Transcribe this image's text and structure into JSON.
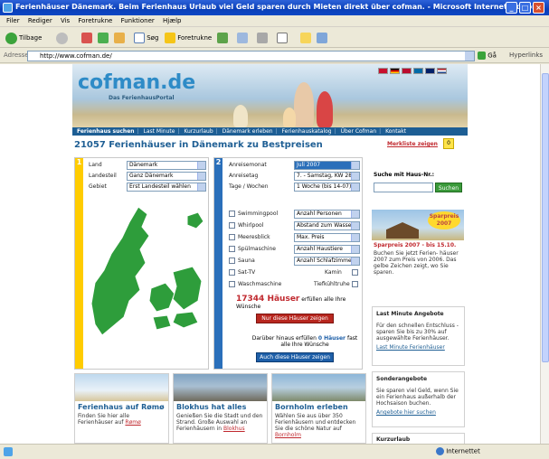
{
  "window": {
    "title": "Ferienhäuser Dänemark. Beim Ferienhaus Urlaub viel Geld sparen durch Mieten direkt über cofman. - Microsoft Internet Explorer"
  },
  "menu": [
    "Filer",
    "Rediger",
    "Vis",
    "Foretrukne",
    "Funktioner",
    "Hjælp"
  ],
  "toolbar": {
    "back": "Tilbage",
    "search": "Søg",
    "favorites": "Foretrukne"
  },
  "address": {
    "label": "Adresse",
    "url": "http://www.cofman.de/",
    "go": "Gå",
    "links": "Hyperlinks"
  },
  "status": {
    "zone": "Internettet"
  },
  "site": {
    "logo": "cofman.de",
    "logo_sub": "Das FerienhausPortal",
    "nav": [
      "Ferienhaus suchen",
      "Last Minute",
      "Kurzurlaub",
      "Dänemark erleben",
      "Ferienhauskatalog",
      "Über Cofman",
      "Kontakt"
    ],
    "headline": "21057 Ferienhäuser in Dänemark zu Bestpreisen",
    "merkliste": "Merkliste zeigen",
    "merkliste_count": "0"
  },
  "step1": {
    "number": "1",
    "fields": [
      {
        "label": "Land",
        "value": "Dänemark"
      },
      {
        "label": "Landesteil",
        "value": "Ganz Dänemark"
      },
      {
        "label": "Gebiet",
        "value": "Erst Landesteil wählen"
      }
    ]
  },
  "step2": {
    "number": "2",
    "fields": [
      {
        "label": "Anreisemonat",
        "value": "Juli 2007"
      },
      {
        "label": "Anreisetag",
        "value": "7. - Samstag, KW 28"
      },
      {
        "label": "Tage / Wochen",
        "value": "1 Woche  (bis 14-07)"
      }
    ],
    "options": [
      {
        "label": "Swimmingpool",
        "select": "Anzahl Personen"
      },
      {
        "label": "Whirlpool",
        "select": "Abstand zum Wasser"
      },
      {
        "label": "Meeresblick",
        "select": "Max. Preis"
      },
      {
        "label": "Spülmaschine",
        "select": "Anzahl Haustiere"
      },
      {
        "label": "Sauna",
        "select": "Anzahl Schlafzimmer"
      }
    ],
    "opt_satv": "Sat-TV",
    "opt_kamin": "Kamin",
    "opt_wasch": "Waschmaschine",
    "opt_tief": "Tiefkühltruhe",
    "count_value": "17344 Häuser",
    "count_suffix": "erfüllen alle Ihre Wünsche",
    "btn_only": "Nur diese Häuser zeigen",
    "extra_prefix": "Darüber hinaus erfüllen",
    "extra_value": "0 Häuser",
    "extra_suffix": "fast alle Ihre Wünsche",
    "btn_also": "Auch diese Häuser zeigen"
  },
  "side": {
    "search_label": "Suche mit Haus-Nr.:",
    "search_button": "Suchen",
    "sparpreis_badge": "Sparpreis 2007",
    "sparpreis_title": "Sparpreis 2007 - bis 15.10.",
    "sparpreis_text": "Buchen Sie jetzt Ferien- häuser 2007 zum Preis von 2006. Das gelbe Zeichen zeigt, wo Sie sparen.",
    "lastminute_title": "Last Minute Angebote",
    "lastminute_text": "Für den schnellen Entschluss - sparen Sie bis zu 30% auf ausgewählte Ferienhäuser.",
    "lastminute_link": "Last Minute Ferienhäuser",
    "sonder_title": "Sonderangebote",
    "sonder_text": "Sie sparen viel Geld, wenn Sie ein Ferienhaus außerhalb der Hochsaison buchen.",
    "sonder_link": "Angebote hier suchen",
    "kurz_title": "Kurzurlaub"
  },
  "teasers": [
    {
      "title": "Ferienhaus auf Rømø",
      "text": "Finden Sie hier alle Ferienhäuser auf ",
      "link": "Rømø"
    },
    {
      "title": "Blokhus hat alles",
      "text": "Genießen Sie die Stadt und den Strand. Große Auswahl an Ferienhäusern in ",
      "link": "Blokhus"
    },
    {
      "title": "Bornholm erleben",
      "text": "Wählen Sie aus über 350 Ferienhäusern und entdecken Sie die schöne Natur auf ",
      "link": "Bornholm"
    }
  ]
}
